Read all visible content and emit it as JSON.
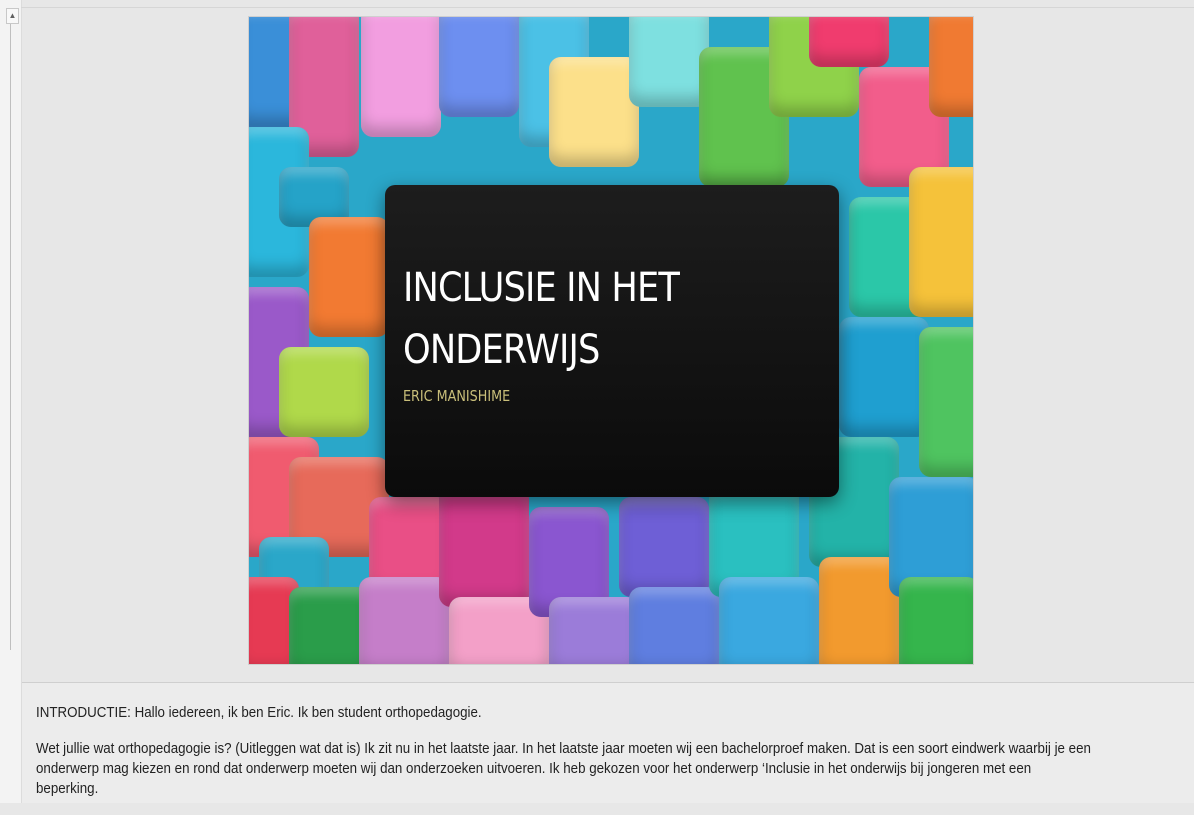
{
  "scrollbar": {
    "up_glyph": "▲"
  },
  "slide": {
    "title": "INCLUSIE IN HET\nONDERWIJS",
    "subtitle": "ERIC MANISHIME",
    "background_description_colors": [
      "#e84a7a",
      "#f5c23a",
      "#3bb3e0",
      "#56c06a",
      "#9b5fd0",
      "#f07a32"
    ]
  },
  "notes": {
    "paragraphs": [
      "INTRODUCTIE: Hallo iedereen, ik ben Eric. Ik ben student orthopedagogie.",
      "Wet jullie wat orthopedagogie is? (Uitleggen wat dat is) Ik zit nu in het laatste jaar. In het laatste jaar moeten wij een bachelorproef maken. Dat is een soort eindwerk waarbij je een onderwerp mag kiezen en rond dat onderwerp moeten wij dan onderzoeken uitvoeren.  Ik heb gekozen voor het onderwerp ‘Inclusie in het onderwijs bij jongeren met een beperking."
    ]
  }
}
